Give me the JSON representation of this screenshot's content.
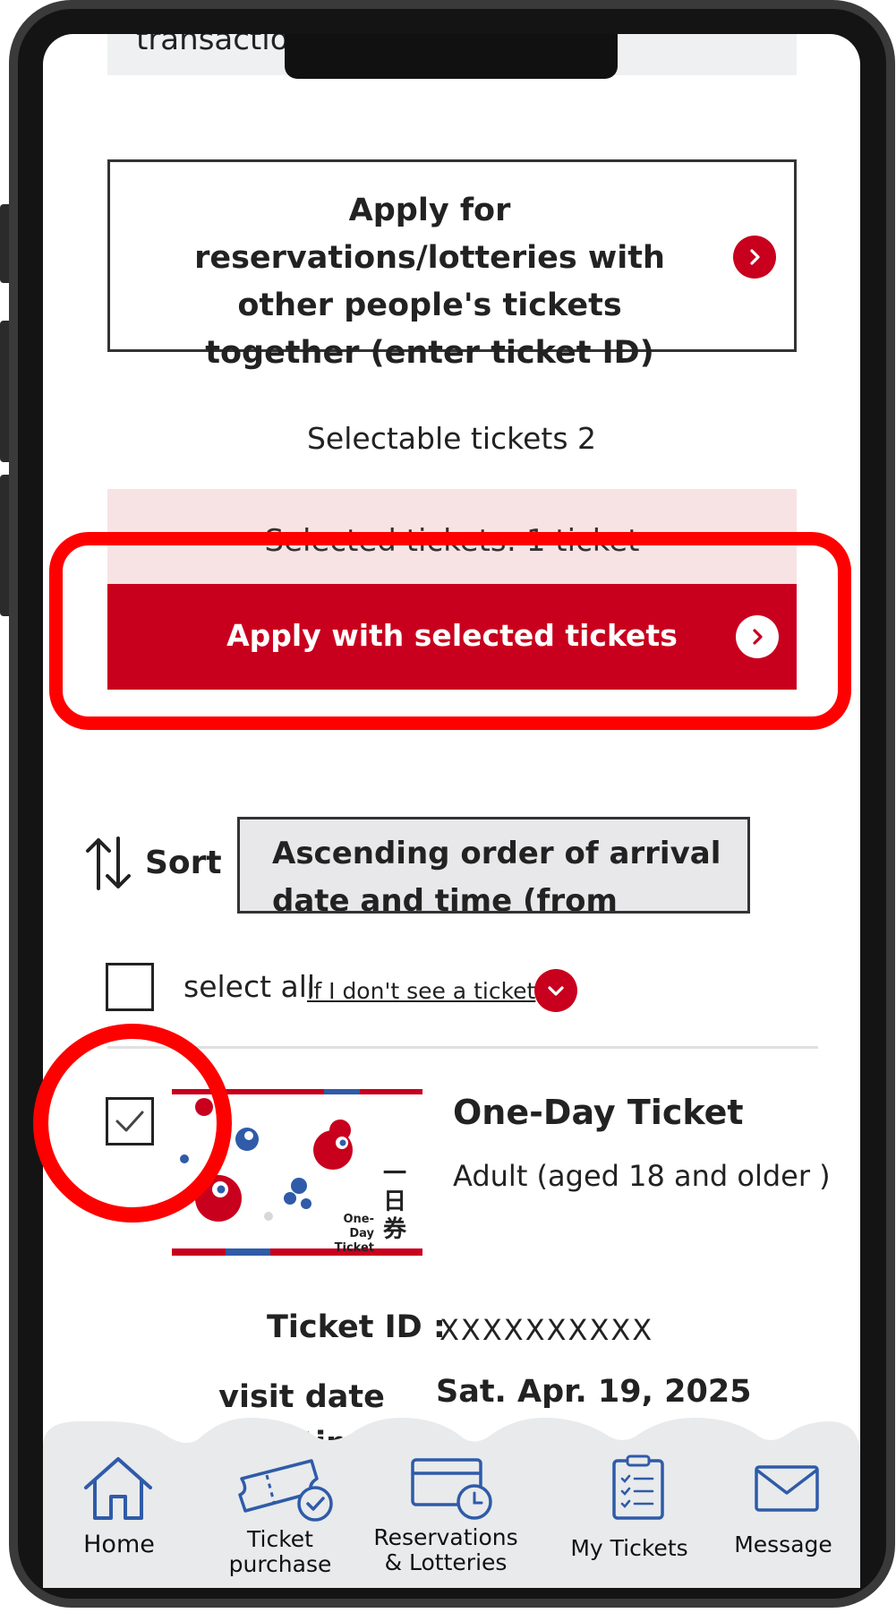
{
  "top_partial_text": "transactio",
  "others_button": {
    "label": "Apply for reservations/lotteries with other people's tickets together (enter ticket ID)"
  },
  "selectable_tickets": "Selectable tickets 2",
  "selected_tickets": "Selected tickets: 1 ticket",
  "apply_button": {
    "label": "Apply with selected tickets"
  },
  "sort": {
    "label": "Sort",
    "selected": "Ascending order of arrival date and time (from nearest"
  },
  "select_all": "select all",
  "missing_ticket_link": "If I don't see a ticket",
  "ticket": {
    "name": "One-Day Ticket",
    "category": "Adult (aged 18 and older )",
    "checked": true,
    "thumb_text_en": "One-Day Ticket",
    "thumb_text_jp": "一日券",
    "id_label": "Ticket ID :",
    "id_value": "XXXXXXXXXX",
    "visit_label": "visit date and time",
    "visit_value": "Sat. Apr. 19, 2025"
  },
  "nav": [
    {
      "label": "Home",
      "icon": "home-icon"
    },
    {
      "label": "Ticket purchase",
      "icon": "ticket-icon"
    },
    {
      "label": "Reservations & Lotteries",
      "icon": "calendar-clock-icon"
    },
    {
      "label": "My Tickets",
      "icon": "clipboard-icon"
    },
    {
      "label": "Message",
      "icon": "envelope-icon"
    }
  ],
  "colors": {
    "accent": "#c8001e",
    "highlight": "#ff0000",
    "pink": "#f8e3e4",
    "nav_icon": "#2f5ba8"
  }
}
